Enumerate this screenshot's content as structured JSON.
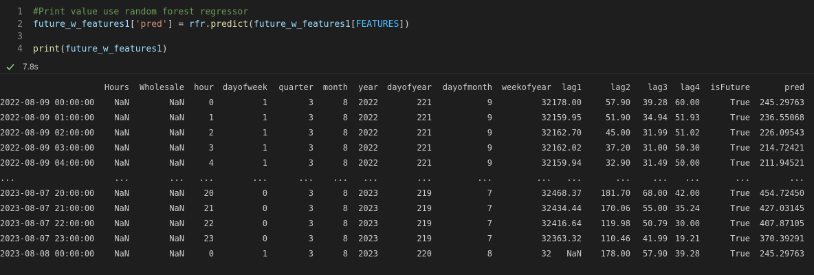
{
  "cell": {
    "lines": [
      {
        "number": "1",
        "tokens": [
          {
            "text": "#Print value use random forest regressor",
            "kind": "comment"
          }
        ]
      },
      {
        "number": "2",
        "tokens": [
          {
            "text": "future_w_features1",
            "kind": "var"
          },
          {
            "text": "[",
            "kind": "plain"
          },
          {
            "text": "'pred'",
            "kind": "str"
          },
          {
            "text": "] = ",
            "kind": "plain"
          },
          {
            "text": "rfr",
            "kind": "var"
          },
          {
            "text": ".",
            "kind": "plain"
          },
          {
            "text": "predict",
            "kind": "fn"
          },
          {
            "text": "(",
            "kind": "plain"
          },
          {
            "text": "future_w_features1",
            "kind": "var"
          },
          {
            "text": "[",
            "kind": "plain"
          },
          {
            "text": "FEATURES",
            "kind": "const"
          },
          {
            "text": "])",
            "kind": "plain"
          }
        ]
      },
      {
        "number": "3",
        "tokens": []
      },
      {
        "number": "4",
        "tokens": [
          {
            "text": "print",
            "kind": "fn"
          },
          {
            "text": "(",
            "kind": "plain"
          },
          {
            "text": "future_w_features1",
            "kind": "var"
          },
          {
            "text": ")",
            "kind": "plain"
          }
        ]
      }
    ],
    "status_icon": "check-icon",
    "execution_time": "7.8s",
    "colors": {
      "comment": "#6a9955",
      "variable": "#9cdcfe",
      "string": "#ce9178",
      "function": "#dcdcaa",
      "constant": "#4fc1ff",
      "success": "#89d185"
    }
  },
  "output": {
    "headers": [
      "",
      "Hours",
      "Wholesale",
      "hour",
      "dayofweek",
      "quarter",
      "month",
      "year",
      "dayofyear",
      "dayofmonth",
      "weekofyear",
      "lag1",
      "lag2",
      "lag3",
      "lag4",
      "isFuture",
      "pred"
    ],
    "rows": [
      [
        "2022-08-09 00:00:00",
        "NaN",
        "NaN",
        "0",
        "1",
        "3",
        "8",
        "2022",
        "221",
        "9",
        "32",
        "178.00",
        "57.90",
        "39.28",
        "60.00",
        "True",
        "245.29763"
      ],
      [
        "2022-08-09 01:00:00",
        "NaN",
        "NaN",
        "1",
        "1",
        "3",
        "8",
        "2022",
        "221",
        "9",
        "32",
        "159.95",
        "51.90",
        "34.94",
        "51.93",
        "True",
        "236.55068"
      ],
      [
        "2022-08-09 02:00:00",
        "NaN",
        "NaN",
        "2",
        "1",
        "3",
        "8",
        "2022",
        "221",
        "9",
        "32",
        "162.70",
        "45.00",
        "31.99",
        "51.02",
        "True",
        "226.09543"
      ],
      [
        "2022-08-09 03:00:00",
        "NaN",
        "NaN",
        "3",
        "1",
        "3",
        "8",
        "2022",
        "221",
        "9",
        "32",
        "162.02",
        "37.20",
        "31.00",
        "50.30",
        "True",
        "214.72421"
      ],
      [
        "2022-08-09 04:00:00",
        "NaN",
        "NaN",
        "4",
        "1",
        "3",
        "8",
        "2022",
        "221",
        "9",
        "32",
        "159.94",
        "32.90",
        "31.49",
        "50.00",
        "True",
        "211.94521"
      ],
      [
        "...",
        "...",
        "...",
        "...",
        "...",
        "...",
        "...",
        "...",
        "...",
        "...",
        "...",
        "...",
        "...",
        "...",
        "...",
        "...",
        "..."
      ],
      [
        "2023-08-07 20:00:00",
        "NaN",
        "NaN",
        "20",
        "0",
        "3",
        "8",
        "2023",
        "219",
        "7",
        "32",
        "468.37",
        "181.70",
        "68.00",
        "42.00",
        "True",
        "454.72450"
      ],
      [
        "2023-08-07 21:00:00",
        "NaN",
        "NaN",
        "21",
        "0",
        "3",
        "8",
        "2023",
        "219",
        "7",
        "32",
        "434.44",
        "170.06",
        "55.00",
        "35.24",
        "True",
        "427.03145"
      ],
      [
        "2023-08-07 22:00:00",
        "NaN",
        "NaN",
        "22",
        "0",
        "3",
        "8",
        "2023",
        "219",
        "7",
        "32",
        "416.64",
        "119.98",
        "50.79",
        "30.00",
        "True",
        "407.87105"
      ],
      [
        "2023-08-07 23:00:00",
        "NaN",
        "NaN",
        "23",
        "0",
        "3",
        "8",
        "2023",
        "219",
        "7",
        "32",
        "363.32",
        "110.46",
        "41.99",
        "19.21",
        "True",
        "370.39291"
      ],
      [
        "2023-08-08 00:00:00",
        "NaN",
        "NaN",
        "0",
        "1",
        "3",
        "8",
        "2023",
        "220",
        "8",
        "32",
        "NaN",
        "178.00",
        "57.90",
        "39.28",
        "True",
        "245.29763"
      ]
    ]
  }
}
